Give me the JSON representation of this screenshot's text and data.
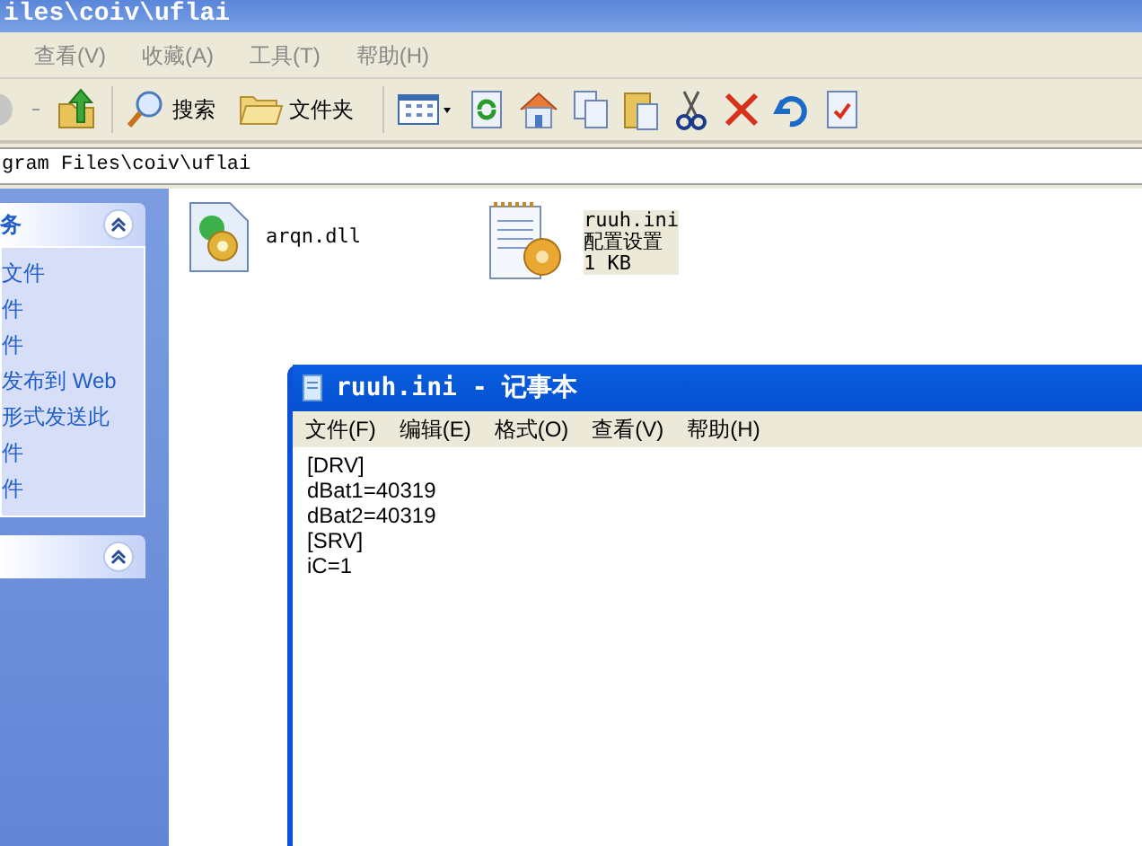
{
  "window": {
    "title": "iles\\coiv\\uflai"
  },
  "menu": [
    {
      "label": "查看(V)"
    },
    {
      "label": "收藏(A)"
    },
    {
      "label": "工具(T)"
    },
    {
      "label": "帮助(H)"
    }
  ],
  "toolbar": {
    "search": "搜索",
    "folders": "文件夹"
  },
  "address": {
    "value": "gram Files\\coiv\\uflai"
  },
  "sidebar": {
    "panels": [
      {
        "title": "务",
        "expanded": true,
        "items": [
          "文件",
          "件",
          "件",
          "发布到 Web",
          "形式发送此",
          "件",
          "件"
        ]
      },
      {
        "expanded": true
      }
    ]
  },
  "files": [
    {
      "kind": "dll",
      "lines": [
        "arqn.dll"
      ],
      "selected": false
    },
    {
      "kind": "ini",
      "lines": [
        "ruuh.ini",
        "配置设置",
        "1 KB"
      ],
      "selected": true
    }
  ],
  "notepad": {
    "title": "ruuh.ini - 记事本",
    "menu": [
      "文件(F)",
      "编辑(E)",
      "格式(O)",
      "查看(V)",
      "帮助(H)"
    ],
    "lines": [
      "[DRV]",
      "dBat1=40319",
      "dBat2=40319",
      "[SRV]",
      "iC=1"
    ]
  }
}
